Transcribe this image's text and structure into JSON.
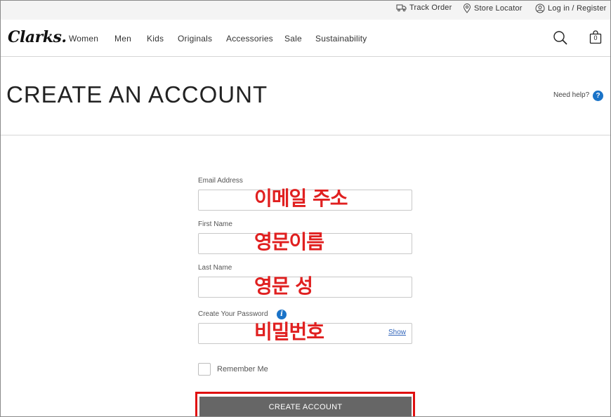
{
  "utility_bar": {
    "track_order": "Track Order",
    "store_locator": "Store Locator",
    "login_register": "Log in / Register"
  },
  "header": {
    "logo": "Clarks.",
    "nav": [
      "Women",
      "Men",
      "Kids",
      "Originals",
      "Accessories",
      "Sale",
      "Sustainability"
    ],
    "bag_count": "0",
    "icons": [
      "search-icon",
      "shopping-bag-icon"
    ]
  },
  "page": {
    "title": "CREATE AN ACCOUNT",
    "need_help": "Need help?",
    "help_icon_glyph": "?"
  },
  "form": {
    "email_label": "Email Address",
    "email_value": "",
    "first_name_label": "First Name",
    "first_name_value": "",
    "last_name_label": "Last Name",
    "last_name_value": "",
    "password_label": "Create Your Password",
    "password_value": "",
    "password_info_glyph": "i",
    "show_label": "Show",
    "remember_label": "Remember Me",
    "remember_checked": false,
    "submit_label": "CREATE ACCOUNT"
  },
  "annotations": {
    "email": "이메일 주소",
    "first_name": "영문이름",
    "last_name": "영문 성",
    "password": "비밀번호",
    "color": "#e02020"
  },
  "colors": {
    "button_bg": "#666666",
    "highlight": "#e01010",
    "info_blue": "#1a73c8",
    "link": "#3366bb"
  }
}
